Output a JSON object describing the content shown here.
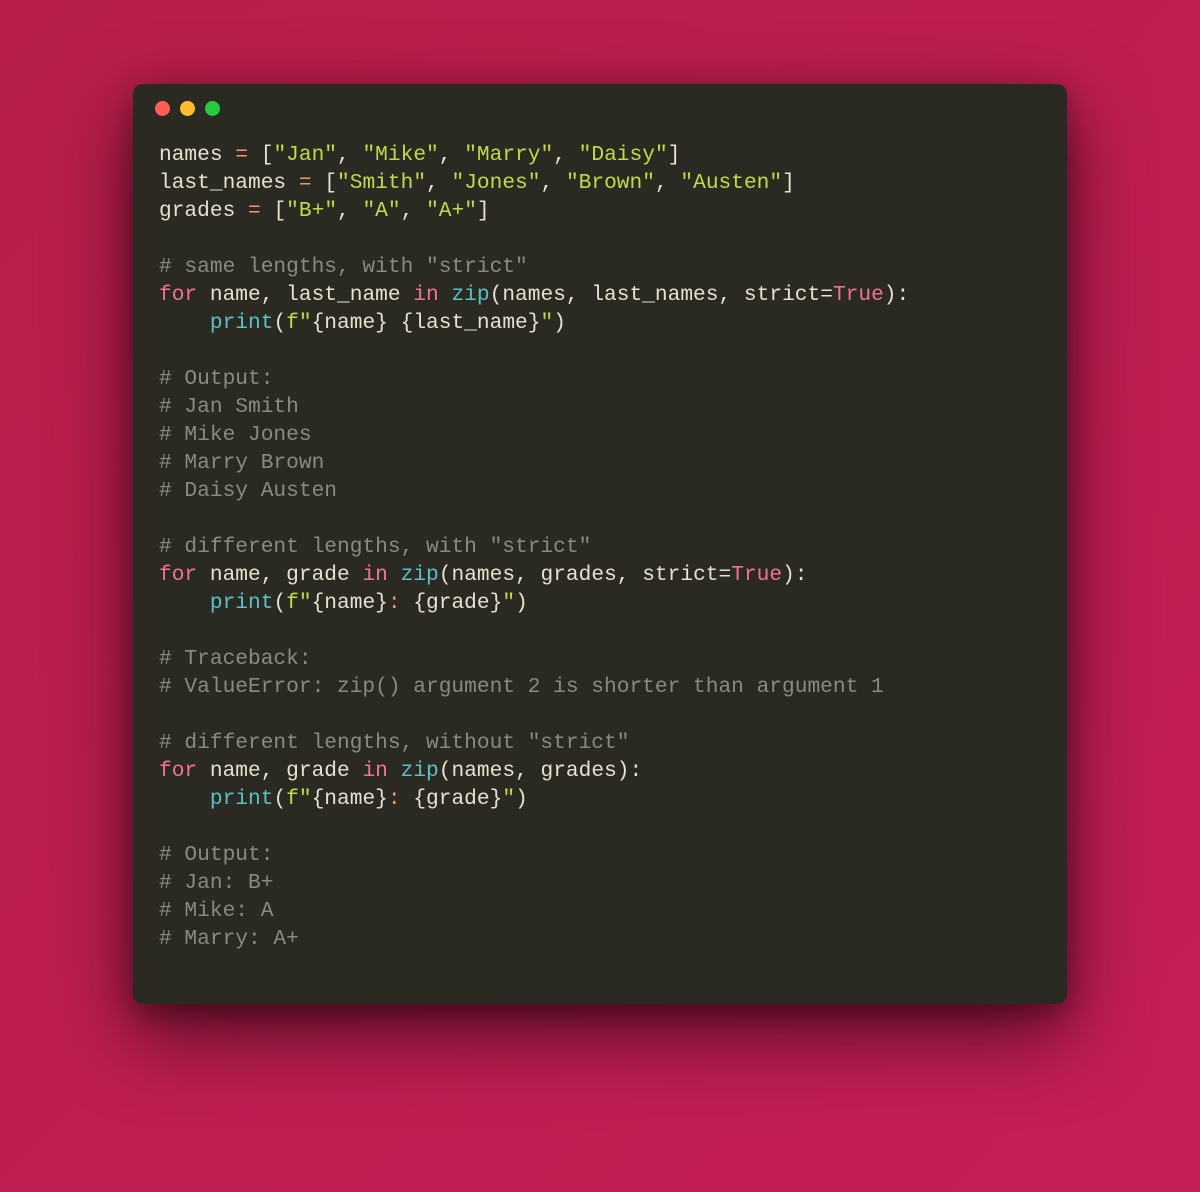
{
  "colors": {
    "bg_gradient_from": "#b81e49",
    "bg_gradient_to": "#c41e56",
    "window_bg": "#2a2a23",
    "dot_red": "#ff5f56",
    "dot_yellow": "#ffbd2e",
    "dot_green": "#27c93f",
    "token_default": "#e6e1cf",
    "token_operator": "#f29668",
    "token_string": "#c2d94c",
    "token_comment": "#8a8a80",
    "token_keyword": "#f2738f",
    "token_builtin": "#5ac1c7"
  },
  "code": {
    "l01": {
      "var": "names",
      "items": [
        "\"Jan\"",
        "\"Mike\"",
        "\"Marry\"",
        "\"Daisy\""
      ]
    },
    "l02": {
      "var": "last_names",
      "items": [
        "\"Smith\"",
        "\"Jones\"",
        "\"Brown\"",
        "\"Austen\""
      ]
    },
    "l03": {
      "var": "grades",
      "items": [
        "\"B+\"",
        "\"A\"",
        "\"A+\""
      ]
    },
    "l05": "# same lengths, with \"strict\"",
    "l06": {
      "for": "for",
      "vars": "name, last_name",
      "in": "in",
      "fn": "zip",
      "args": "names, last_names, strict=",
      "true": "True"
    },
    "l07": {
      "fn": "print",
      "pre": "f\"",
      "p1": "{name}",
      "sp": " ",
      "p2": "{last_name}",
      "post": "\""
    },
    "l09": "# Output:",
    "l10": "# Jan Smith",
    "l11": "# Mike Jones",
    "l12": "# Marry Brown",
    "l13": "# Daisy Austen",
    "l15": "# different lengths, with \"strict\"",
    "l16": {
      "for": "for",
      "vars": "name, grade",
      "in": "in",
      "fn": "zip",
      "args": "names, grades, strict=",
      "true": "True"
    },
    "l17": {
      "fn": "print",
      "pre": "f\"",
      "p1": "{name}",
      "colon": ":",
      "sp": " ",
      "p2": "{grade}",
      "post": "\""
    },
    "l19": "# Traceback:",
    "l20": "# ValueError: zip() argument 2 is shorter than argument 1",
    "l22": "# different lengths, without \"strict\"",
    "l23": {
      "for": "for",
      "vars": "name, grade",
      "in": "in",
      "fn": "zip",
      "args": "names, grades"
    },
    "l24": {
      "fn": "print",
      "pre": "f\"",
      "p1": "{name}",
      "colon": ":",
      "sp": " ",
      "p2": "{grade}",
      "post": "\""
    },
    "l26": "# Output:",
    "l27": "# Jan: B+",
    "l28": "# Mike: A",
    "l29": "# Marry: A+"
  }
}
